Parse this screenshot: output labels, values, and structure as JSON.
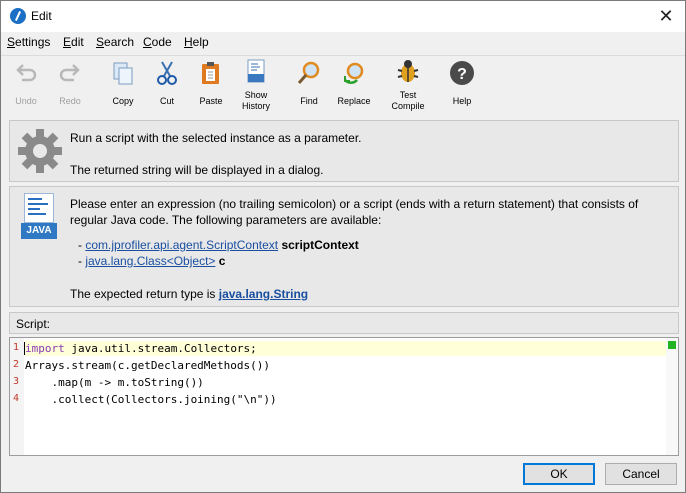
{
  "window": {
    "title": "Edit",
    "close_glyph": "✕"
  },
  "menu": [
    {
      "label": "Settings",
      "mnemonic": "S",
      "rest": "ettings"
    },
    {
      "label": "Edit",
      "mnemonic": "E",
      "rest": "dit"
    },
    {
      "label": "Search",
      "mnemonic": "S",
      "rest": "earch"
    },
    {
      "label": "Code",
      "mnemonic": "C",
      "rest": "ode"
    },
    {
      "label": "Help",
      "mnemonic": "H",
      "rest": "elp"
    }
  ],
  "toolbar": {
    "undo": "Undo",
    "redo": "Redo",
    "copy": "Copy",
    "cut": "Cut",
    "paste": "Paste",
    "history_line1": "Show",
    "history_line2": "History",
    "find": "Find",
    "replace": "Replace",
    "compile_line1": "Test",
    "compile_line2": "Compile",
    "help": "Help"
  },
  "info1": {
    "line1": "Run a script with the selected instance as a parameter.",
    "line2": "The returned string will be displayed in a dialog."
  },
  "info2": {
    "intro_line1": "Please enter an expression (no trailing semicolon) or a script (ends with a return statement) that consists of",
    "intro_line2": "regular Java code. The following parameters are available:",
    "params": [
      {
        "type": "com.jprofiler.api.agent.ScriptContext",
        "name": "scriptContext"
      },
      {
        "type": "java.lang.Class<Object>",
        "name": "c"
      }
    ],
    "return_prefix": "The expected return type is ",
    "return_type": "java.lang.String",
    "icon_label": "JAVA"
  },
  "script": {
    "label": "Script:",
    "line_numbers": [
      "1",
      "2",
      "3",
      "4"
    ],
    "lines": [
      {
        "kw": "import",
        "rest": " java.util.stream.Collectors;"
      },
      {
        "kw": "",
        "rest": "Arrays.stream(c.getDeclaredMethods())"
      },
      {
        "kw": "",
        "rest": "    .map(m -> m.toString())"
      },
      {
        "kw": "",
        "rest": "    .collect(Collectors.joining(\"\\n\"))"
      }
    ]
  },
  "buttons": {
    "ok": "OK",
    "cancel": "Cancel"
  },
  "colors": {
    "link": "#1a4fa0",
    "keyword": "#8a3ab3",
    "status_ok": "#22b422"
  }
}
